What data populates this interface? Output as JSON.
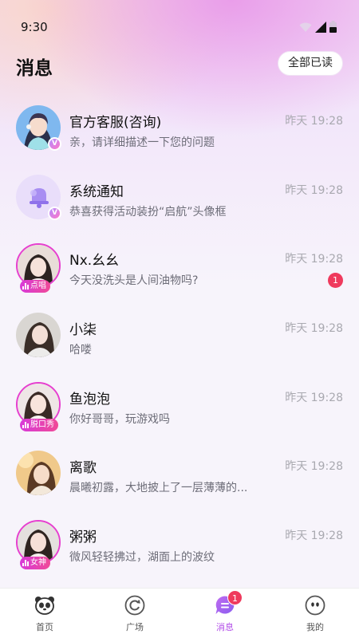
{
  "status": {
    "time": "9:30"
  },
  "header": {
    "title": "消息",
    "read_all": "全部已读"
  },
  "conversations": [
    {
      "name": "官方客服(咨询)",
      "time": "昨天 19:28",
      "preview": "亲，请详细描述一下您的问题",
      "verified": "V"
    },
    {
      "name": "系统通知",
      "time": "昨天 19:28",
      "preview": "恭喜获得活动装扮“启航”头像框",
      "verified": "V"
    },
    {
      "name": "Nx.幺幺",
      "time": "昨天 19:28",
      "preview": "今天没洗头是人间油物吗?",
      "tag": "点唱",
      "unread": "1"
    },
    {
      "name": "小柒",
      "time": "昨天 19:28",
      "preview": "哈喽"
    },
    {
      "name": "鱼泡泡",
      "time": "昨天 19:28",
      "preview": "你好哥哥，玩游戏吗",
      "tag": "脱口秀"
    },
    {
      "name": "离歌",
      "time": "昨天 19:28",
      "preview": "晨曦初露，大地披上了一层薄薄的..."
    },
    {
      "name": "粥粥",
      "time": "昨天 19:28",
      "preview": "微风轻轻拂过，湖面上的波纹",
      "tag": "女神"
    }
  ],
  "tabs": [
    {
      "label": "首页",
      "icon": "panda-icon"
    },
    {
      "label": "广场",
      "icon": "square-refresh-icon"
    },
    {
      "label": "消息",
      "icon": "chat-bubble-icon",
      "badge": "1",
      "active": true
    },
    {
      "label": "我的",
      "icon": "profile-face-icon"
    }
  ],
  "colors": {
    "accent": "#b14ce8",
    "badge": "#ef3a5d",
    "ring": "#e63fcf"
  }
}
